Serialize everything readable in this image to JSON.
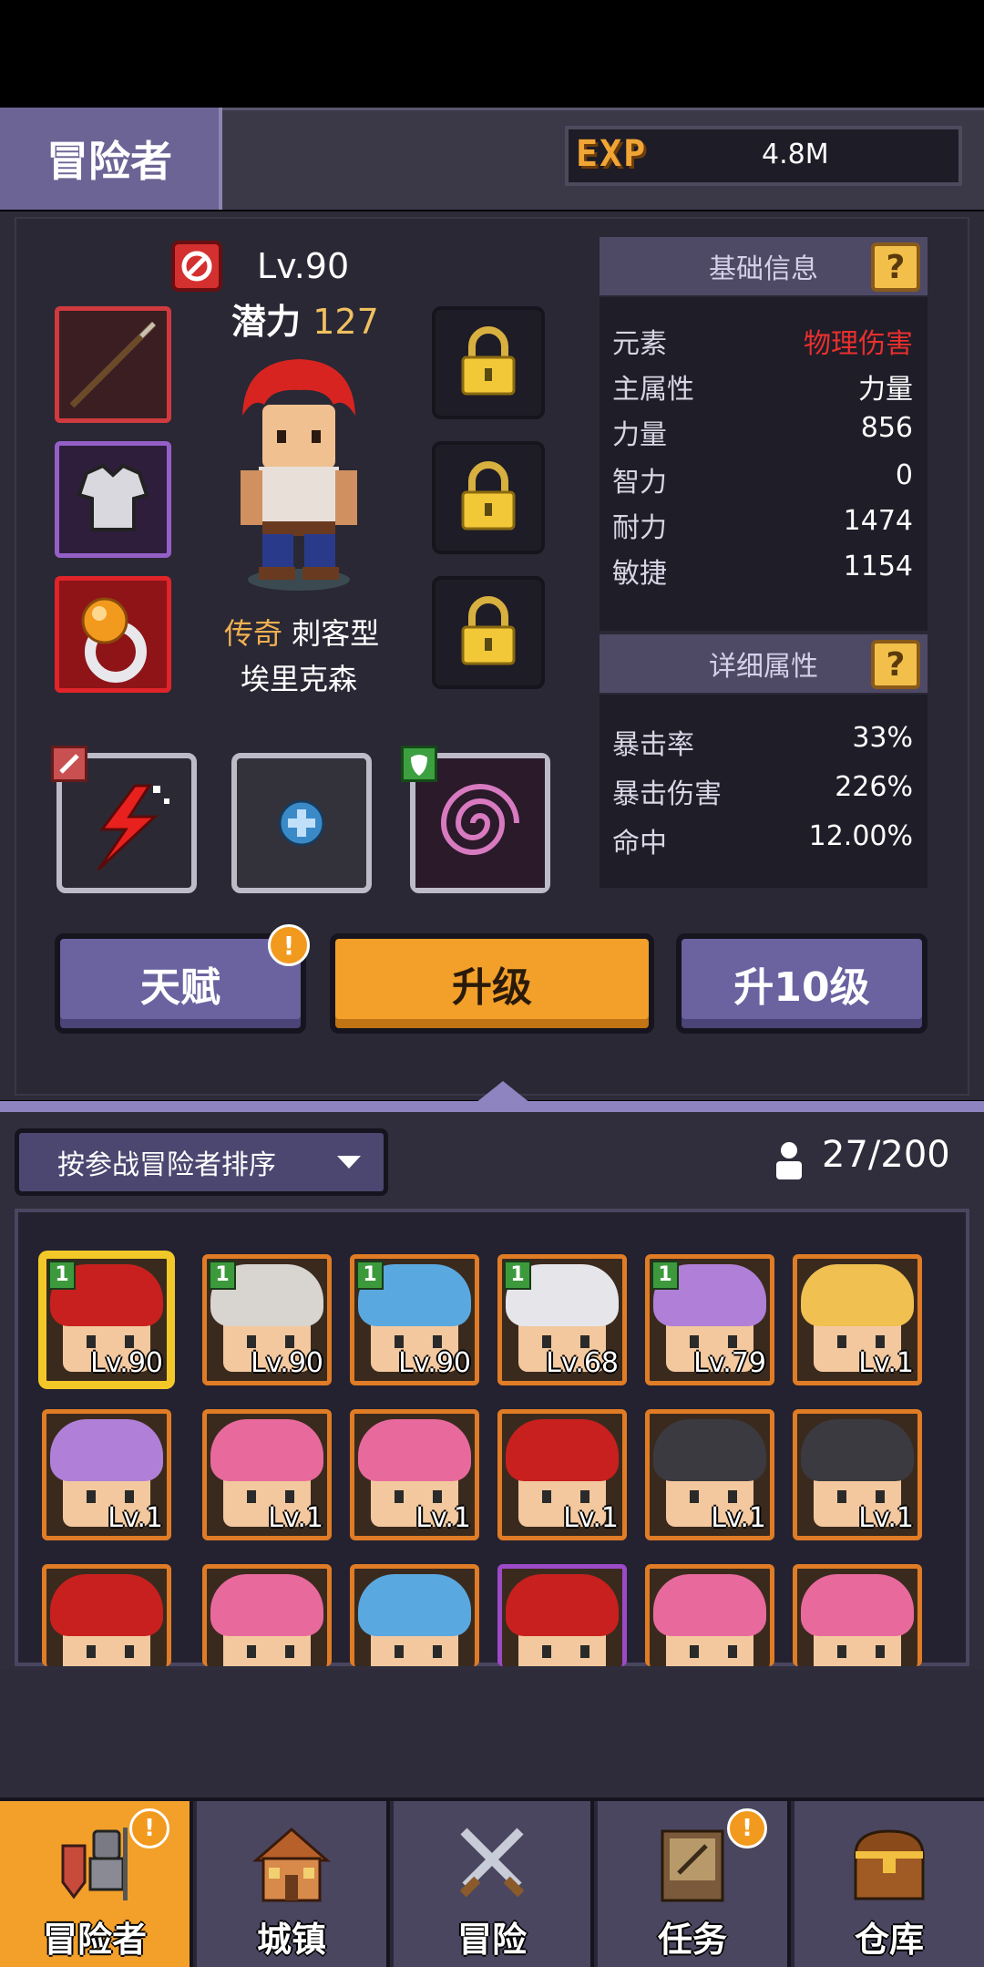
{
  "header": {
    "title": "冒险者",
    "exp_label": "EXP",
    "exp_value": "4.8M"
  },
  "hero": {
    "level": "Lv.90",
    "potential_label": "潜力",
    "potential_value": "127",
    "rarity": "传奇",
    "class": "刺客型",
    "name": "埃里克森"
  },
  "basic_info": {
    "title": "基础信息",
    "help": "?",
    "rows": [
      {
        "k": "元素",
        "v": "物理伤害"
      },
      {
        "k": "主属性",
        "v": "力量"
      },
      {
        "k": "力量",
        "v": "856"
      },
      {
        "k": "智力",
        "v": "0"
      },
      {
        "k": "耐力",
        "v": "1474"
      },
      {
        "k": "敏捷",
        "v": "1154"
      }
    ]
  },
  "detail_info": {
    "title": "详细属性",
    "help": "?",
    "rows": [
      {
        "k": "暴击率",
        "v": "33%"
      },
      {
        "k": "暴击伤害",
        "v": "226%"
      },
      {
        "k": "命中",
        "v": "12.00%"
      }
    ]
  },
  "colors": {
    "element_value": "#e8302e",
    "accent_orange": "#f2a02a",
    "panel_purple": "#6a63a0"
  },
  "actions": {
    "talent": "天赋",
    "talent_alert": "!",
    "upgrade": "升级",
    "upgrade10": "升10级"
  },
  "list": {
    "sort_label": "按参战冒险者排序",
    "roster_count": "27/200",
    "cards": [
      {
        "lv": "Lv.90",
        "tag": "1",
        "hair": "#c8201e"
      },
      {
        "lv": "Lv.90",
        "tag": "1",
        "hair": "#d8d4d0"
      },
      {
        "lv": "Lv.90",
        "tag": "1",
        "hair": "#5aa8e0"
      },
      {
        "lv": "Lv.68",
        "tag": "1",
        "hair": "#e6e6ea"
      },
      {
        "lv": "Lv.79",
        "tag": "1",
        "hair": "#b080d8"
      },
      {
        "lv": "Lv.1",
        "tag": "",
        "hair": "#f0c050"
      },
      {
        "lv": "Lv.1",
        "tag": "",
        "hair": "#b080d8"
      },
      {
        "lv": "Lv.1",
        "tag": "",
        "hair": "#e86a9c"
      },
      {
        "lv": "Lv.1",
        "tag": "",
        "hair": "#e86a9c"
      },
      {
        "lv": "Lv.1",
        "tag": "",
        "hair": "#c8201e"
      },
      {
        "lv": "Lv.1",
        "tag": "",
        "hair": "#3a3a40"
      },
      {
        "lv": "Lv.1",
        "tag": "",
        "hair": "#3a3a40"
      },
      {
        "lv": "",
        "tag": "",
        "hair": "#c8201e"
      },
      {
        "lv": "",
        "tag": "",
        "hair": "#e86a9c"
      },
      {
        "lv": "",
        "tag": "",
        "hair": "#5aa8e0"
      },
      {
        "lv": "",
        "tag": "",
        "hair": "#c8201e"
      },
      {
        "lv": "",
        "tag": "",
        "hair": "#e86a9c"
      },
      {
        "lv": "",
        "tag": "",
        "hair": "#e86a9c"
      }
    ]
  },
  "nav": {
    "items": [
      {
        "label": "冒险者",
        "icon": "knight-icon",
        "alert": "!"
      },
      {
        "label": "城镇",
        "icon": "house-icon",
        "alert": ""
      },
      {
        "label": "冒险",
        "icon": "crossed-swords-icon",
        "alert": ""
      },
      {
        "label": "任务",
        "icon": "quest-book-icon",
        "alert": "!"
      },
      {
        "label": "仓库",
        "icon": "treasure-chest-icon",
        "alert": ""
      }
    ]
  }
}
